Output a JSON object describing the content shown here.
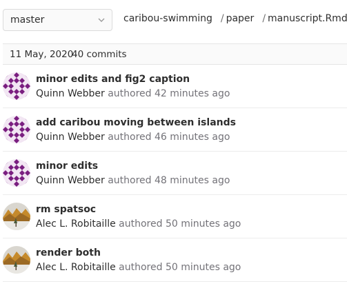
{
  "branch": {
    "selected": "master"
  },
  "breadcrumb": {
    "project": "caribou-swimming",
    "separator": "/",
    "folder": "paper",
    "file": "manuscript.Rmd"
  },
  "day_header": {
    "date": "11 May, 2020",
    "count": "40 commits"
  },
  "commits": [
    {
      "title": "minor edits and fig2 caption",
      "author": "Quinn Webber",
      "action": "authored",
      "time": "42 minutes ago",
      "avatar": "identicon-purple"
    },
    {
      "title": "add caribou moving between islands",
      "author": "Quinn Webber",
      "action": "authored",
      "time": "46 minutes ago",
      "avatar": "identicon-purple"
    },
    {
      "title": "minor edits",
      "author": "Quinn Webber",
      "action": "authored",
      "time": "48 minutes ago",
      "avatar": "identicon-purple"
    },
    {
      "title": "rm spatsoc",
      "author": "Alec L. Robitaille",
      "action": "authored",
      "time": "50 minutes ago",
      "avatar": "photo-landscape"
    },
    {
      "title": "render both",
      "author": "Alec L. Robitaille",
      "action": "authored",
      "time": "50 minutes ago",
      "avatar": "photo-landscape"
    }
  ],
  "colors": {
    "identicon": "#7a1e80",
    "text": "#2e2e2e",
    "muted": "#737278"
  }
}
